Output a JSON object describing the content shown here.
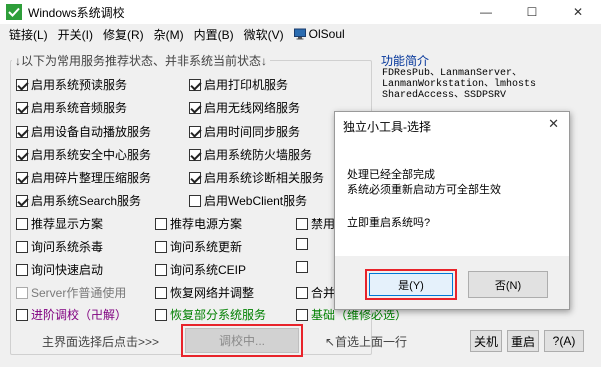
{
  "window": {
    "title": "Windows系统调校",
    "icon": "check-icon",
    "minimize": "—",
    "maximize": "☐",
    "close": "✕"
  },
  "menu": [
    {
      "label": "链接(L)"
    },
    {
      "label": "开关(I)"
    },
    {
      "label": "修复(R)"
    },
    {
      "label": "杂(M)"
    },
    {
      "label": "内置(B)"
    },
    {
      "label": "微软(V)"
    },
    {
      "label": "OlSoul",
      "icon": "monitor-icon"
    }
  ],
  "group": {
    "title": "↓以下为常用服务推荐状态、并非系统当前状态↓"
  },
  "info": {
    "title": "功能简介",
    "lines": [
      "FDResPub、LanmanServer、",
      "LanmanWorkstation、lmhosts",
      "SharedAccess、SSDPSRV"
    ]
  },
  "services_col1": [
    {
      "label": "启用系统预读服务",
      "checked": true
    },
    {
      "label": "启用系统音频服务",
      "checked": true
    },
    {
      "label": "启用设备自动播放服务",
      "checked": true
    },
    {
      "label": "启用系统安全中心服务",
      "checked": true
    },
    {
      "label": "启用碎片整理压缩服务",
      "checked": true
    },
    {
      "label": "启用系统Search服务",
      "checked": true
    }
  ],
  "services_col2": [
    {
      "label": "启用打印机服务",
      "checked": true
    },
    {
      "label": "启用无线网络服务",
      "checked": true
    },
    {
      "label": "启用时间同步服务",
      "checked": true
    },
    {
      "label": "启用系统防火墙服务",
      "checked": true
    },
    {
      "label": "启用系统诊断相关服务",
      "checked": true
    },
    {
      "label": "启用WebClient服务",
      "checked": false
    }
  ],
  "options": {
    "r1c1": "推荐显示方案",
    "r1c2": "推荐电源方案",
    "r1c3": "禁用",
    "r2c1": "询问系统杀毒",
    "r2c2": "询问系统更新",
    "r3c1": "询问快速启动",
    "r3c2": "询问系统CEIP",
    "r4c1": "Server作普通使用",
    "r4c2": "恢复网络并调整",
    "r4c3": "合并",
    "r5c1": "进阶调校（卍解）",
    "r5c2": "恢复部分系统服务",
    "r5c3": "基础（维修必选）"
  },
  "bottom": {
    "left_hint": "主界面选择后点击>>>",
    "tune_button": "调校中...",
    "right_hint": "↖首选上面一行",
    "shutdown": "关机",
    "restart": "重启",
    "help": "?(A)"
  },
  "dialog": {
    "title": "独立小工具-选择",
    "close": "✕",
    "line1": "处理已经全部完成",
    "line2": "系统必须重新启动方可全部生效",
    "question": "立即重启系统吗?",
    "yes": "是(Y)",
    "no": "否(N)"
  }
}
